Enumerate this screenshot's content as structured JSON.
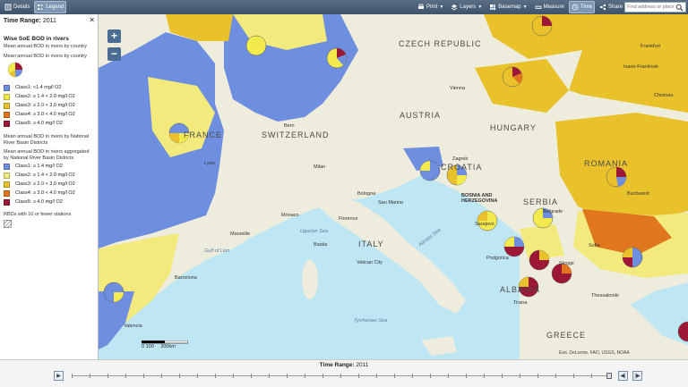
{
  "toolbar": {
    "details": "Details",
    "legend": "Legend",
    "print": "Print",
    "layers": "Layers",
    "basemap": "Basemap",
    "measure": "Measure",
    "time": "Time",
    "share": "Share",
    "search_placeholder": "Find address or place"
  },
  "panel": {
    "time_range_label": "Time Range:",
    "time_range_value": "2011",
    "layer_title": "Wise SoE BOD in rivers",
    "group1_title": "Mean annual BOD in rivers by country",
    "group1_sub": "Mean annual BOD in rivers by country",
    "classes1": [
      {
        "label": "Class1: <1.4 mg/l O2",
        "color": "#6e8ee0"
      },
      {
        "label": "Class2: ≥ 1.4 < 2.0 mg/l O2",
        "color": "#f3ea4e"
      },
      {
        "label": "Class3: ≥ 2.0 < 3.0 mg/l O2",
        "color": "#e9c22b"
      },
      {
        "label": "Class4: ≥ 3.0 < 4.0 mg/l O2",
        "color": "#e0761e"
      },
      {
        "label": "Class5: ≥ 4.0 mg/l O2",
        "color": "#9c1836"
      }
    ],
    "group2_title": "Mean annual BOD in rivers by National River Basin Districts",
    "group2_sub": "Mean annual BOD in rivers aggregated by National River Basin Districts",
    "classes2": [
      {
        "label": "Class1: ≥ 1.4 mg/l O2",
        "color": "#6e8ee0"
      },
      {
        "label": "Class2: ≥ 1.4 < 2.0 mg/l O2",
        "color": "#f3ea7e"
      },
      {
        "label": "Class3: ≥ 2.0 < 3.0 mg/l O2",
        "color": "#e9c22b"
      },
      {
        "label": "Class4: ≥ 3.0 < 4.0 mg/l O2",
        "color": "#e0761e"
      },
      {
        "label": "Class5: ≥ 4.0 mg/l O2",
        "color": "#9c1836"
      }
    ],
    "rbd_note": "RBDs with 10 or fewer stations"
  },
  "map": {
    "countries": [
      "CZECH REPUBLIC",
      "AUSTRIA",
      "HUNGARY",
      "ROMANIA",
      "SWITZERLAND",
      "FRANCE",
      "CROATIA",
      "BOSNIA AND HERZEGOVINA",
      "SERBIA",
      "ITALY",
      "ALBANIA",
      "GREECE"
    ],
    "cities": [
      "Vienna",
      "Bern",
      "Lyon",
      "Milan",
      "Bologna",
      "Florence",
      "Monaco",
      "Marseille",
      "Barcelona",
      "Valencia",
      "Belgrade",
      "Bucharest",
      "Podgorica",
      "Tirana",
      "Skopje",
      "Sofia",
      "Vatican City",
      "San Marino",
      "Bastia",
      "Thessaloniki",
      "Sarajevo",
      "Zagreb",
      "Frankfurt",
      "Ivano-Frankivsk",
      "Chisinau"
    ],
    "seas": [
      "Ligurian Sea",
      "Adriatic Sea",
      "Gulf of Lion",
      "Tyrrhenian Sea"
    ],
    "scale_0": "0",
    "scale_mid": "100",
    "scale_end": "200km",
    "attribution": "Esri, DeLorme, FAO, USGS, NOAA",
    "colors": {
      "class1": "#6e8ee0",
      "class2": "#f3ea4e",
      "class3": "#e9c22b",
      "class4": "#e0761e",
      "class5": "#9c1836"
    }
  },
  "timebar": {
    "label": "Time Range:",
    "value": "2011"
  }
}
